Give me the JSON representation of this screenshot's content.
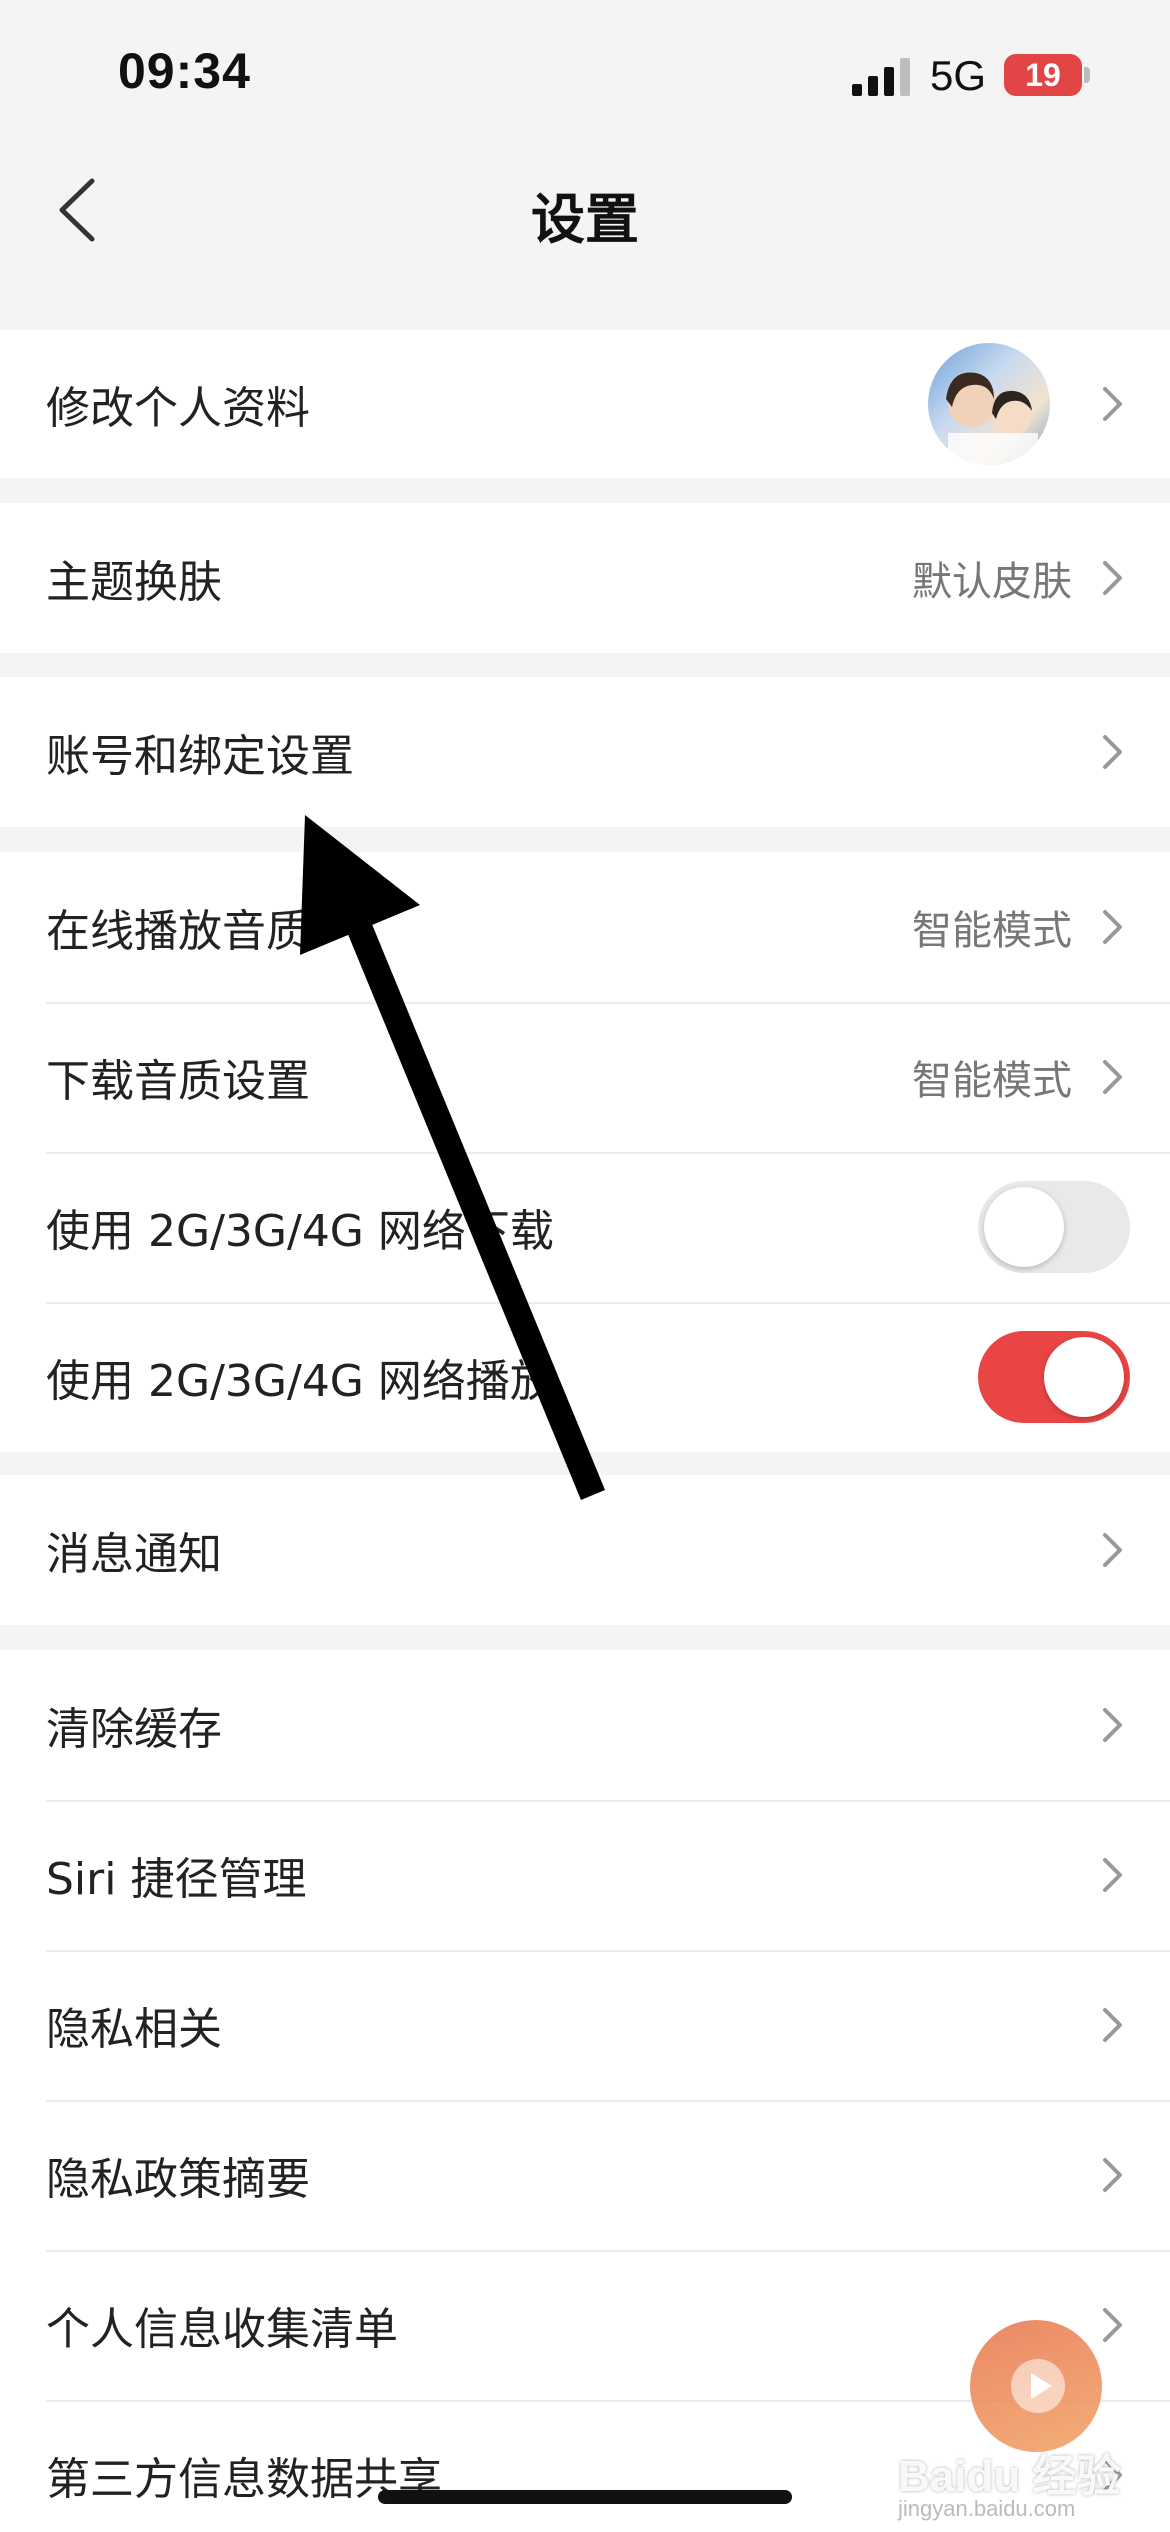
{
  "status_bar": {
    "time": "09:34",
    "network": "5G",
    "battery": "19"
  },
  "nav": {
    "title": "设置"
  },
  "groups": [
    {
      "items": [
        {
          "label": "修改个人资料",
          "value": ""
        }
      ]
    },
    {
      "items": [
        {
          "label": "主题换肤",
          "value": "默认皮肤"
        }
      ]
    },
    {
      "items": [
        {
          "label": "账号和绑定设置",
          "value": ""
        }
      ]
    },
    {
      "items": [
        {
          "label": "在线播放音质",
          "value": "智能模式"
        },
        {
          "label": "下载音质设置",
          "value": "智能模式"
        },
        {
          "label": "使用 2G/3G/4G 网络下载",
          "toggle": false
        },
        {
          "label": "使用 2G/3G/4G 网络播放",
          "toggle": true
        }
      ]
    },
    {
      "items": [
        {
          "label": "消息通知",
          "value": ""
        }
      ]
    },
    {
      "items": [
        {
          "label": "清除缓存"
        },
        {
          "label": "Siri 捷径管理"
        },
        {
          "label": "隐私相关"
        },
        {
          "label": "隐私政策摘要"
        },
        {
          "label": "个人信息收集清单"
        },
        {
          "label": "第三方信息数据共享"
        }
      ]
    }
  ],
  "watermark": {
    "brand": "Baidu 经验",
    "url": "jingyan.baidu.com"
  },
  "icons": {
    "back": "chevron-left-icon",
    "chevron": "chevron-right-icon",
    "signal": "signal-icon",
    "battery": "battery-icon",
    "play": "play-icon"
  },
  "colors": {
    "accent": "#e94545",
    "toggle_off": "#e9e9ea",
    "background": "#f4f4f4"
  }
}
